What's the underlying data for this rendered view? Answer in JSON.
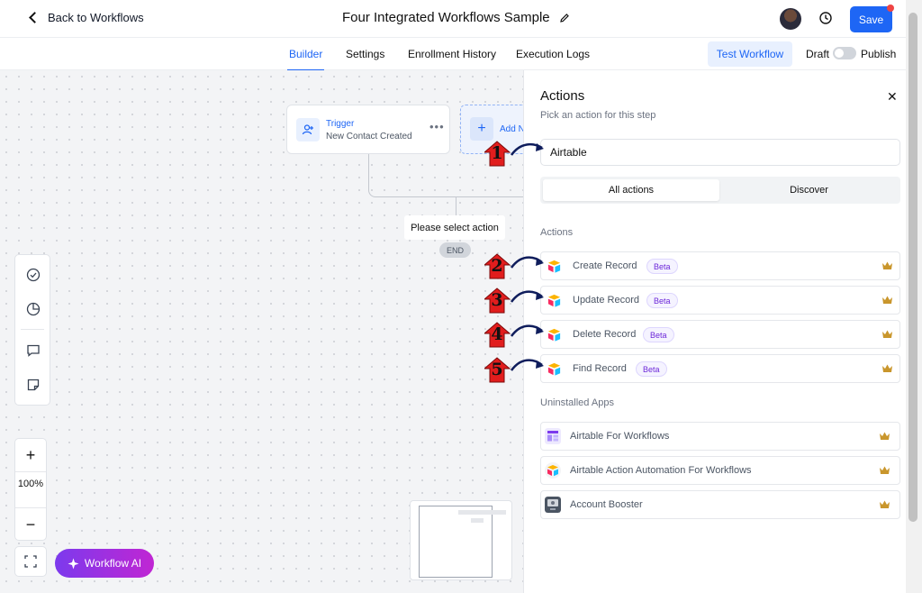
{
  "header": {
    "back_label": "Back to Workflows",
    "workflow_title": "Four Integrated Workflows Sample",
    "save_label": "Save"
  },
  "tabs": [
    {
      "label": "Builder",
      "active": true
    },
    {
      "label": "Settings",
      "active": false
    },
    {
      "label": "Enrollment History",
      "active": false
    },
    {
      "label": "Execution Logs",
      "active": false
    }
  ],
  "toolbar": {
    "test_label": "Test Workflow",
    "draft_label": "Draft",
    "publish_label": "Publish"
  },
  "canvas": {
    "trigger_label": "Trigger",
    "trigger_event": "New Contact Created",
    "add_node_label": "Add N",
    "select_action_label": "Please select action",
    "end_label": "END",
    "zoom_level": "100%",
    "ai_label": "Workflow AI"
  },
  "panel": {
    "title": "Actions",
    "subtitle": "Pick an action for this step",
    "search_value": "Airtable",
    "segments": [
      "All actions",
      "Discover"
    ],
    "actions_heading": "Actions",
    "actions": [
      {
        "label": "Create Record",
        "badge": "Beta"
      },
      {
        "label": "Update Record",
        "badge": "Beta"
      },
      {
        "label": "Delete Record",
        "badge": "Beta"
      },
      {
        "label": "Find Record",
        "badge": "Beta"
      }
    ],
    "uninstalled_heading": "Uninstalled Apps",
    "apps": [
      {
        "label": "Airtable For Workflows"
      },
      {
        "label": "Airtable Action Automation For Workflows"
      },
      {
        "label": "Account Booster"
      }
    ]
  },
  "markers": [
    "1",
    "2",
    "3",
    "4",
    "5"
  ],
  "colors": {
    "accent": "#1e66f5",
    "marker_red": "#e11d1d",
    "arrow_navy": "#0f1d5c",
    "crown_gold": "#c9962c"
  }
}
